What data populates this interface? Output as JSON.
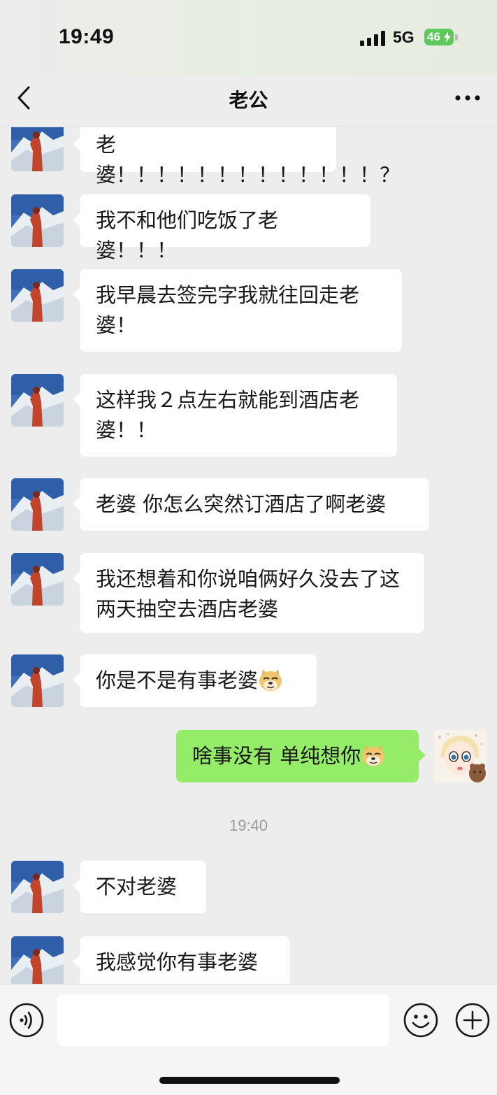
{
  "status": {
    "time": "19:49",
    "network": "5G",
    "battery": "46"
  },
  "header": {
    "title": "老公",
    "back_icon": "chevron-left-icon",
    "more_icon": "more-dots-icon"
  },
  "messages": [
    {
      "side": "left",
      "text": "老婆！！！！！！！！！！！！！？"
    },
    {
      "side": "left",
      "text": "我不和他们吃饭了老婆！！！"
    },
    {
      "side": "left",
      "text": "我早晨去签完字我就往回走老婆！"
    },
    {
      "side": "left",
      "text": "这样我２点左右就能到酒店老婆！！"
    },
    {
      "side": "left",
      "text": "老婆 你怎么突然订酒店了啊老婆"
    },
    {
      "side": "left",
      "text": "我还想着和你说咱俩好久没去了这两天抽空去酒店老婆"
    },
    {
      "side": "left",
      "text": "你是不是有事老婆",
      "emoji": "doge-emoji"
    },
    {
      "side": "right",
      "text": "啥事没有 单纯想你",
      "emoji": "doge-emoji"
    },
    {
      "timestamp": "19:40"
    },
    {
      "side": "left",
      "text": "不对老婆"
    },
    {
      "side": "left",
      "text": "我感觉你有事老婆"
    }
  ],
  "input": {
    "placeholder": "",
    "voice_icon": "voice-icon",
    "emoji_icon": "smiley-icon",
    "plus_icon": "plus-circle-icon"
  },
  "colors": {
    "background": "#ededed",
    "bubble_left": "#ffffff",
    "bubble_right": "#95ec69",
    "battery": "#5cc95a"
  }
}
